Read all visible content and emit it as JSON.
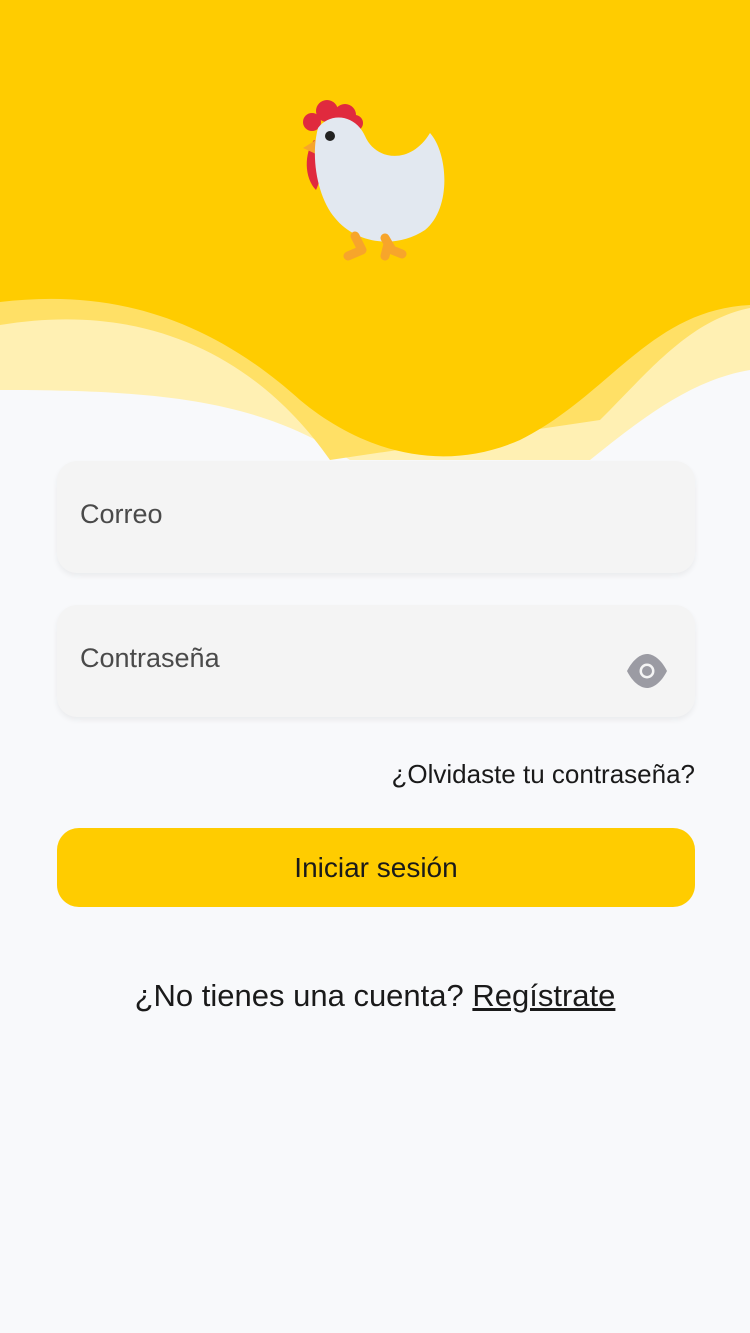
{
  "colors": {
    "brand_yellow": "#ffcc00",
    "wave_light": "#ffe066",
    "wave_pale": "#fff0b3",
    "background": "#f8f9fb",
    "field_background": "#f4f4f4"
  },
  "header": {
    "logo_icon": "chicken-icon"
  },
  "login_form": {
    "email": {
      "placeholder": "Correo",
      "value": ""
    },
    "password": {
      "placeholder": "Contraseña",
      "value": "",
      "toggle_icon": "eye-icon"
    },
    "forgot_link": "¿Olvidaste tu contraseña?",
    "submit_label": "Iniciar sesión"
  },
  "signup": {
    "prompt": "¿No tienes una cuenta?",
    "link": "Regístrate"
  }
}
